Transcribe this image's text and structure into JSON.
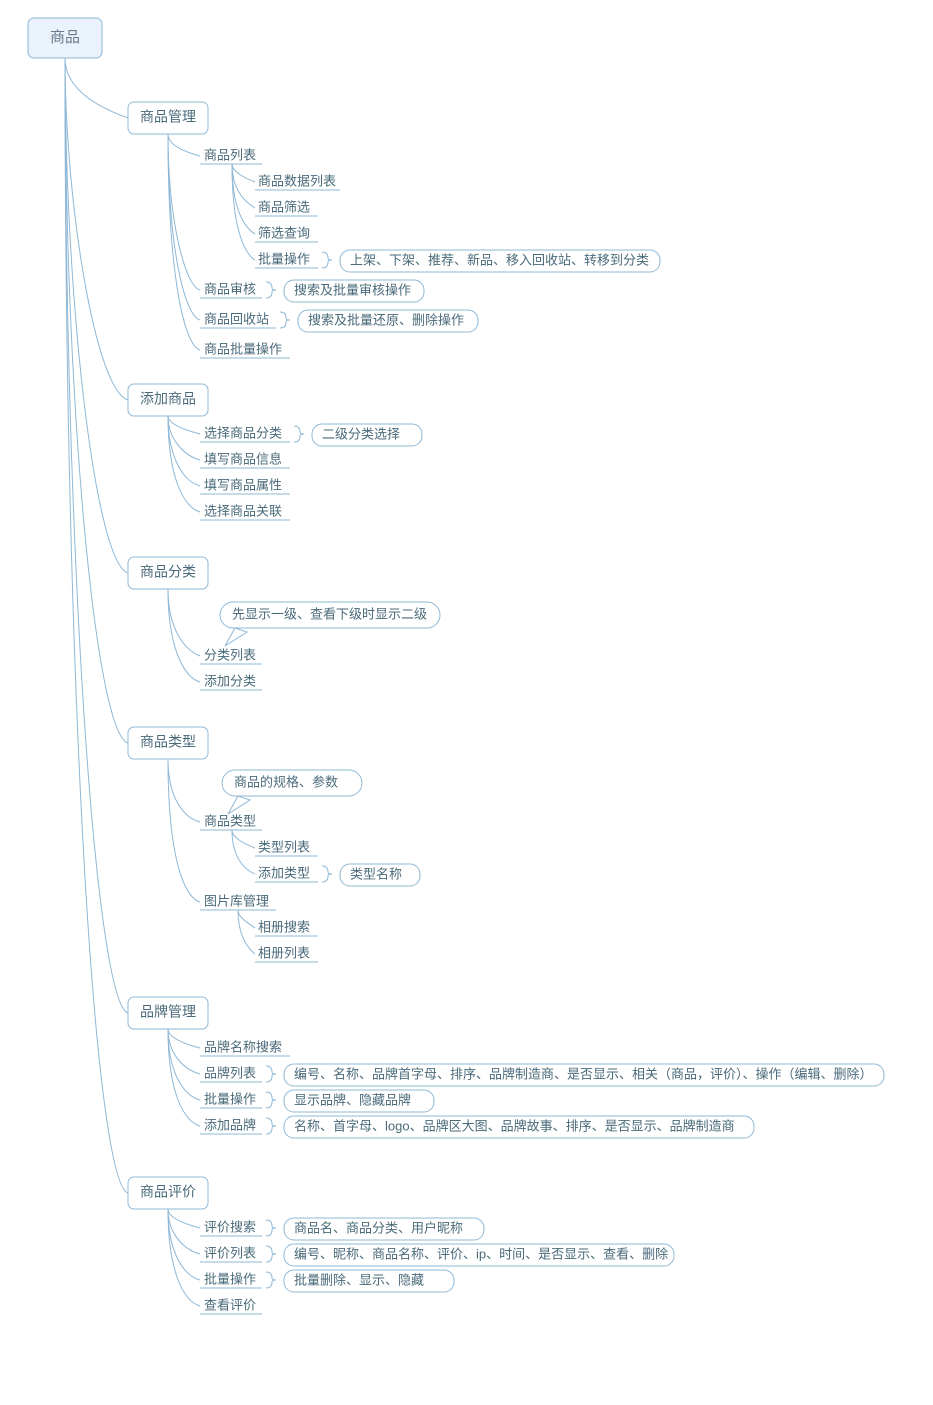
{
  "root": "商品",
  "b1": {
    "title": "商品管理",
    "c1": {
      "title": "商品列表",
      "leaves": [
        "商品数据列表",
        "商品筛选",
        "筛选查询",
        "批量操作"
      ],
      "pill": "上架、下架、推荐、新品、移入回收站、转移到分类"
    },
    "c2": {
      "title": "商品审核",
      "pill": "搜索及批量审核操作"
    },
    "c3": {
      "title": "商品回收站",
      "pill": "搜索及批量还原、删除操作"
    },
    "c4": {
      "title": "商品批量操作"
    }
  },
  "b2": {
    "title": "添加商品",
    "leaves": [
      "选择商品分类",
      "填写商品信息",
      "填写商品属性",
      "选择商品关联"
    ],
    "pill": "二级分类选择"
  },
  "b3": {
    "title": "商品分类",
    "cloud": "先显示一级、查看下级时显示二级",
    "leaves": [
      "分类列表",
      "添加分类"
    ]
  },
  "b4": {
    "title": "商品类型",
    "cloud": "商品的规格、参数",
    "c1": {
      "title": "商品类型",
      "leaves": [
        "类型列表",
        "添加类型"
      ],
      "pill": "类型名称"
    },
    "c2": {
      "title": "图片库管理",
      "leaves": [
        "相册搜索",
        "相册列表"
      ]
    }
  },
  "b5": {
    "title": "品牌管理",
    "leaves": [
      "品牌名称搜索",
      "品牌列表",
      "批量操作",
      "添加品牌"
    ],
    "pills": [
      "编号、名称、品牌首字母、排序、品牌制造商、是否显示、相关（商品，评价）、操作（编辑、删除）",
      "显示品牌、隐藏品牌",
      "名称、首字母、logo、品牌区大图、品牌故事、排序、是否显示、品牌制造商"
    ]
  },
  "b6": {
    "title": "商品评价",
    "leaves": [
      "评价搜索",
      "评价列表",
      "批量操作",
      "查看评价"
    ],
    "pills": [
      "商品名、商品分类、用户昵称",
      "编号、昵称、商品名称、评价、ip、时间、是否显示、查看、删除",
      "批量删除、显示、隐藏"
    ]
  }
}
